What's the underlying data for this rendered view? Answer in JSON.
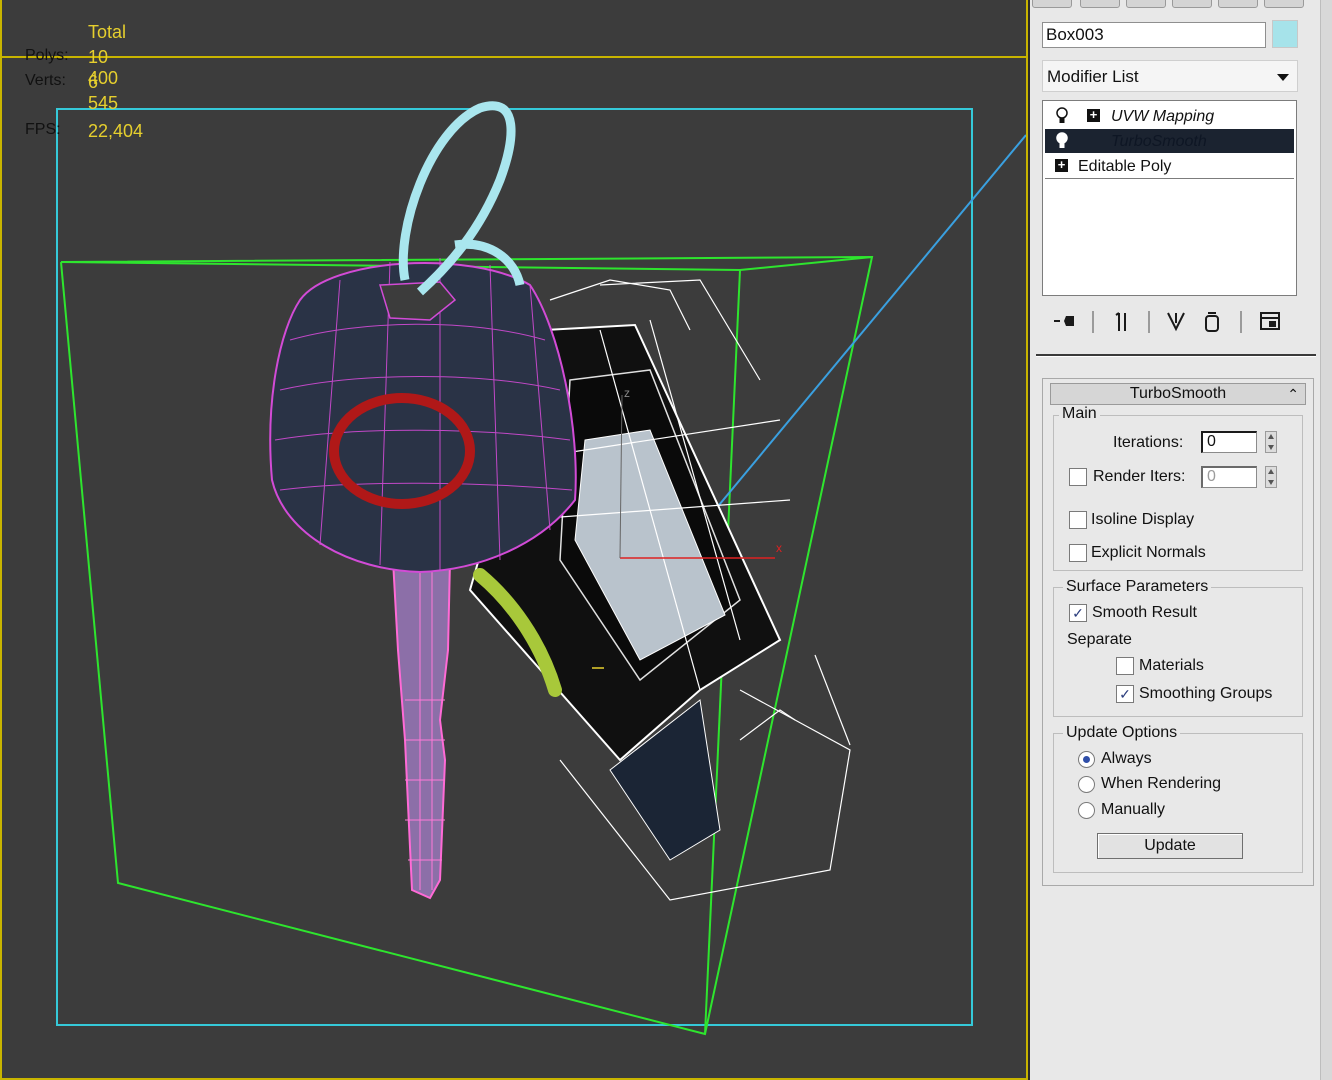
{
  "viewport": {
    "stats": {
      "header": "Total",
      "polys_label": "Polys:",
      "polys_value": "10 400",
      "verts_label": "Verts:",
      "verts_value": "6 545",
      "fps_label": "FPS:",
      "fps_value": "22,404"
    },
    "gizmo": {
      "x_label": "x",
      "z_label": "z"
    },
    "colors": {
      "stats": "#e6cf2e",
      "frame": "#c8b400",
      "bbox_cyan": "#35c9d9",
      "bbox_green": "#2ee52e",
      "wire_magenta": "#d24bd6",
      "ring_red": "#b01818"
    }
  },
  "panel": {
    "object_name": "Box003",
    "object_color": "#a6e3ea",
    "modifier_list": "Modifier List",
    "stack": [
      {
        "label": "UVW Mapping",
        "icon": "lightbulb-icon",
        "expandable": true,
        "italic": true
      },
      {
        "label": "TurboSmooth",
        "icon": "lightbulb-icon",
        "expandable": false,
        "italic": true,
        "selected": true
      },
      {
        "label": "Editable Poly",
        "icon": "",
        "expandable": true,
        "italic": false
      }
    ],
    "stack_tools": [
      "pin-stack-icon",
      "show-end-result-icon",
      "make-unique-icon",
      "remove-modifier-icon",
      "configure-modifier-sets-icon"
    ],
    "rollout": {
      "title": "TurboSmooth",
      "main": {
        "title": "Main",
        "iterations_label": "Iterations:",
        "iterations_value": "0",
        "render_iters_label": "Render Iters:",
        "render_iters_value": "0",
        "render_iters_checked": false,
        "isoline_label": "Isoline Display",
        "isoline_checked": false,
        "explicit_normals_label": "Explicit Normals",
        "explicit_normals_checked": false
      },
      "surface": {
        "title": "Surface Parameters",
        "smooth_result_label": "Smooth Result",
        "smooth_result_checked": true,
        "separate_label": "Separate",
        "materials_label": "Materials",
        "materials_checked": false,
        "smoothing_groups_label": "Smoothing Groups",
        "smoothing_groups_checked": true
      },
      "update": {
        "title": "Update Options",
        "options": [
          "Always",
          "When Rendering",
          "Manually"
        ],
        "selected": "Always",
        "button_label": "Update"
      }
    }
  }
}
